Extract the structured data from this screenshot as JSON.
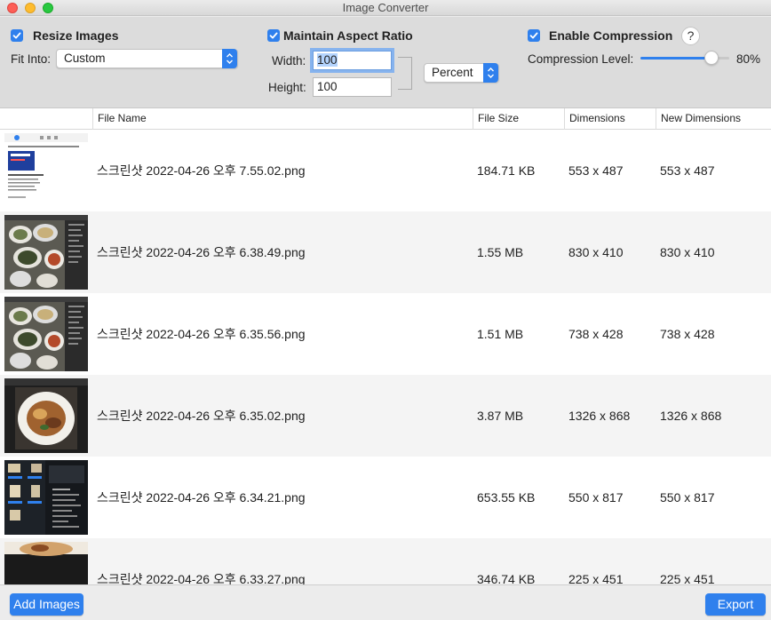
{
  "window": {
    "title": "Image Converter"
  },
  "settings": {
    "resize": {
      "label": "Resize Images",
      "checked": true
    },
    "fit_into": {
      "label": "Fit Into:",
      "value": "Custom"
    },
    "aspect": {
      "label": "Maintain Aspect Ratio",
      "checked": true
    },
    "width": {
      "label": "Width:",
      "value": "100"
    },
    "height": {
      "label": "Height:",
      "value": "100"
    },
    "unit": {
      "value": "Percent"
    },
    "compression": {
      "label": "Enable Compression",
      "checked": true,
      "help": "?"
    },
    "compression_level": {
      "label": "Compression Level:",
      "value": 80,
      "value_text": "80%"
    }
  },
  "table": {
    "columns": [
      "",
      "File Name",
      "File Size",
      "Dimensions",
      "New Dimensions"
    ],
    "rows": [
      {
        "name": "스크린샷 2022-04-26 오후 7.55.02.png",
        "size": "184.71 KB",
        "dims": "553 x 487",
        "new_dims": "553 x 487",
        "thumb": "document"
      },
      {
        "name": "스크린샷 2022-04-26 오후 6.38.49.png",
        "size": "1.55 MB",
        "dims": "830 x 410",
        "new_dims": "830 x 410",
        "thumb": "food-dark"
      },
      {
        "name": "스크린샷 2022-04-26 오후 6.35.56.png",
        "size": "1.51 MB",
        "dims": "738 x 428",
        "new_dims": "738 x 428",
        "thumb": "food-dark"
      },
      {
        "name": "스크린샷 2022-04-26 오후 6.35.02.png",
        "size": "3.87 MB",
        "dims": "1326 x 868",
        "new_dims": "1326 x 868",
        "thumb": "food-plate"
      },
      {
        "name": "스크린샷 2022-04-26 오후 6.34.21.png",
        "size": "653.55 KB",
        "dims": "550 x 817",
        "new_dims": "550 x 817",
        "thumb": "app-dark"
      },
      {
        "name": "스크린샷 2022-04-26 오후 6.33.27.png",
        "size": "346.74 KB",
        "dims": "225 x 451",
        "new_dims": "225 x 451",
        "thumb": "food-top"
      }
    ]
  },
  "buttons": {
    "add_images": "Add Images",
    "export": "Export"
  },
  "colors": {
    "accent": "#2f80ed"
  }
}
